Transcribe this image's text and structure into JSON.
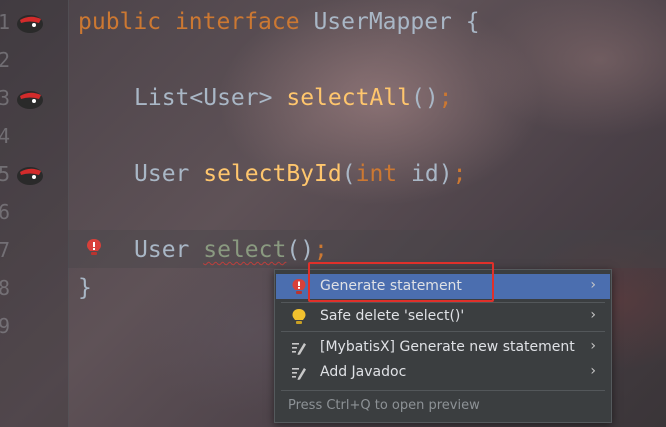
{
  "editor": {
    "line_numbers": [
      "1",
      "2",
      "3",
      "4",
      "5",
      "6",
      "7",
      "8",
      "9"
    ],
    "line1": {
      "kw_public": "public",
      "kw_interface": "interface",
      "name": "UserMapper",
      "brace": "{"
    },
    "line3": {
      "type": "List<User>",
      "method": "selectAll",
      "parens": "()",
      "semi": ";"
    },
    "line5": {
      "type": "User",
      "method": "selectById",
      "open": "(",
      "param_type": "int",
      "param": "id",
      "close": ")",
      "semi": ";"
    },
    "line7": {
      "type": "User",
      "method": "select",
      "parens": "()",
      "semi": ";"
    },
    "line8": {
      "brace": "}"
    }
  },
  "gutter_icons": [
    "mybatis-icon",
    "mybatis-icon",
    "mybatis-icon"
  ],
  "context_menu": {
    "items": [
      {
        "label": "Generate statement",
        "icon": "red-bulb-icon",
        "arrow": "›",
        "selected": true
      },
      {
        "label": "Safe delete 'select()'",
        "icon": "yellow-bulb-icon",
        "arrow": "›"
      },
      {
        "label": "[MybatisX] Generate new statement",
        "icon": "edit-icon",
        "arrow": "›"
      },
      {
        "label": "Add Javadoc",
        "icon": "edit-icon",
        "arrow": "›"
      }
    ],
    "hint": "Press Ctrl+Q to open preview"
  },
  "colors": {
    "keyword": "#cc7832",
    "identifier": "#a9b7c6",
    "method": "#ffc66d",
    "menu_bg": "#3b3e40",
    "selection": "#4b6eaf",
    "highlight_box": "#e0302a"
  }
}
